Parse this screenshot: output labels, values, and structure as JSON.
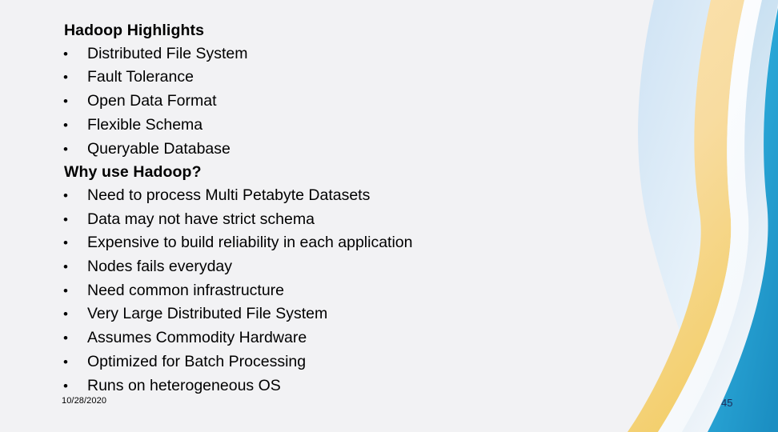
{
  "slide": {
    "background_color": "#f2f2f4",
    "text_color": "#000000",
    "bullet_glyph": "•",
    "blocks": [
      {
        "type": "heading",
        "text": "Hadoop Highlights"
      },
      {
        "type": "bullet",
        "text": "Distributed File System"
      },
      {
        "type": "bullet",
        "text": "Fault Tolerance"
      },
      {
        "type": "bullet",
        "text": "Open Data Format"
      },
      {
        "type": "bullet",
        "text": "Flexible Schema"
      },
      {
        "type": "bullet",
        "text": "Queryable Database"
      },
      {
        "type": "heading",
        "text": "Why use Hadoop?"
      },
      {
        "type": "bullet",
        "text": "Need to process Multi Petabyte Datasets"
      },
      {
        "type": "bullet",
        "text": "Data may not have strict schema"
      },
      {
        "type": "bullet",
        "text": "Expensive to build reliability in each application"
      },
      {
        "type": "bullet",
        "text": "Nodes fails everyday"
      },
      {
        "type": "bullet",
        "text": "Need common infrastructure"
      },
      {
        "type": "bullet",
        "text": "Very Large Distributed File System"
      },
      {
        "type": "bullet",
        "text": "Assumes Commodity Hardware"
      },
      {
        "type": "bullet",
        "text": "Optimized for Batch Processing"
      },
      {
        "type": "bullet",
        "text": "Runs on heterogeneous OS"
      }
    ]
  },
  "footer": {
    "date": "10/28/2020",
    "page_number": "45",
    "page_number_color": "#1f2a57"
  },
  "decoration": {
    "name": "corner-swoosh-graphic",
    "colors": {
      "pale_blue": "#dceaf7",
      "pale_blue_light": "#eef5fb",
      "amber": "#f7d98f",
      "amber_light": "#fbe6b8",
      "white_band": "#ffffff",
      "sky": "#9ecde8",
      "cyan": "#29a8d8",
      "cyan_deep": "#1f93c6"
    }
  }
}
